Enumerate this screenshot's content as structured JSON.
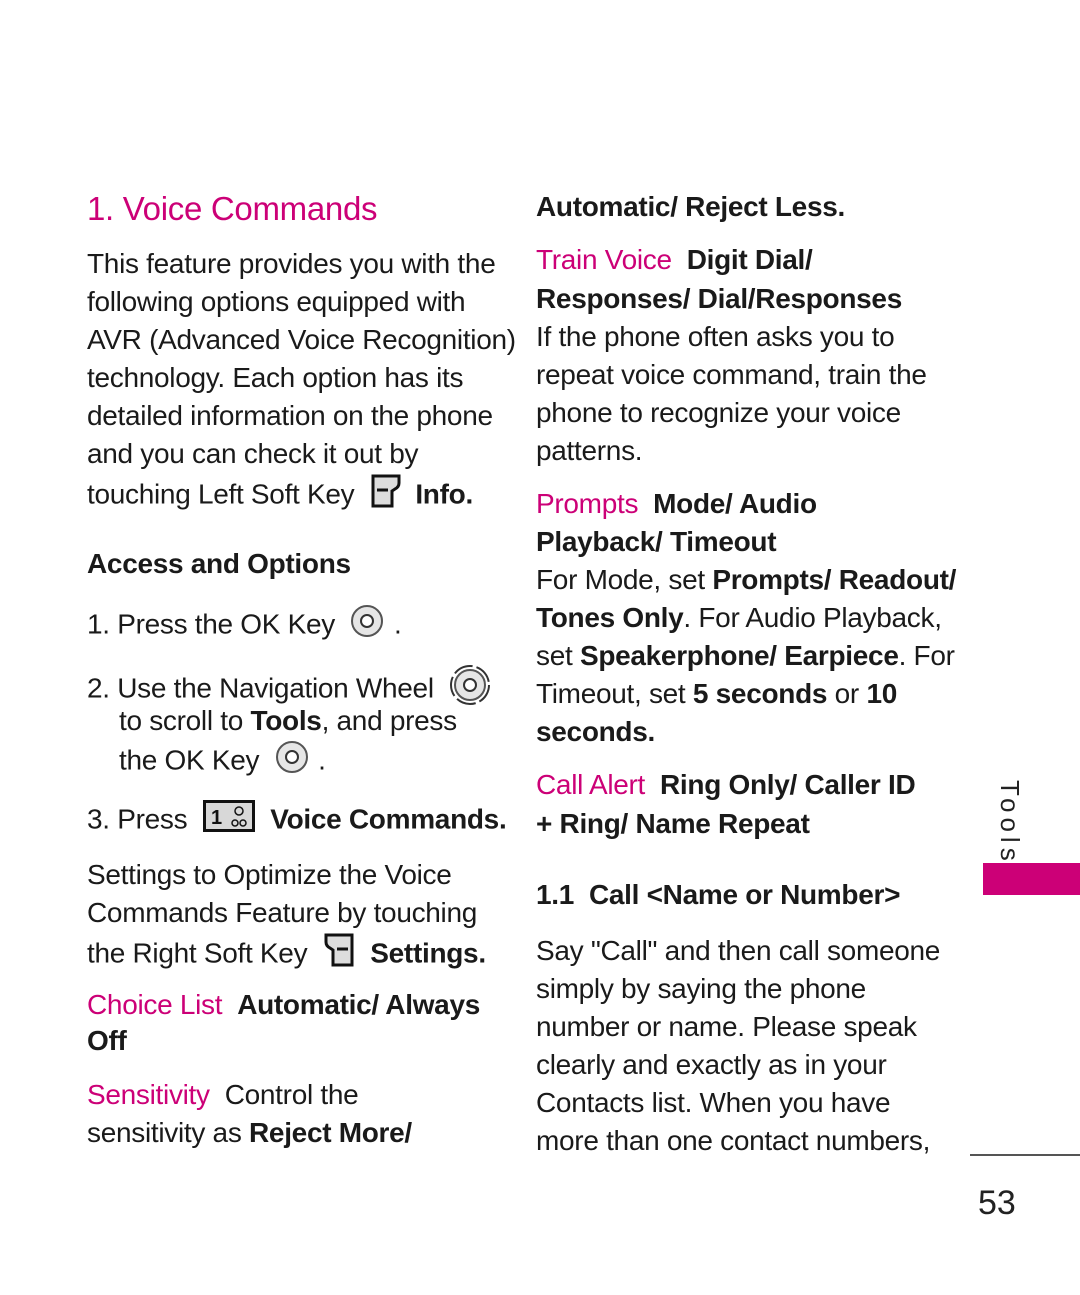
{
  "colors": {
    "accent": "#cc0077",
    "text": "#1a1a1a"
  },
  "section": {
    "title": "1. Voice Commands",
    "tab_label": "Tools",
    "page_number": "53"
  },
  "intro": {
    "lines": [
      "This feature provides you with the",
      "following options equipped with",
      "AVR (Advanced Voice Recognition)",
      "technology. Each option has its",
      "detailed information on the phone",
      "and you can check it out by",
      "touching Left Soft Key"
    ],
    "left_soft_key_label": "Info."
  },
  "access": {
    "heading": "Access and Options",
    "step1": {
      "text": "1. Press the OK Key",
      "end": "."
    },
    "step2": {
      "line1": "2. Use the Navigation Wheel",
      "line2_pre": "to scroll to ",
      "line2_bold": "Tools",
      "line2_post": ", and press",
      "line3": "the OK Key",
      "end": "."
    },
    "step3": {
      "text": "3. Press",
      "key_label": "1",
      "bold": "Voice Commands."
    }
  },
  "settings_intro": {
    "lines": [
      "Settings to Optimize the Voice",
      "Commands Feature by touching",
      "the Right Soft Key"
    ],
    "right_soft_key_label": "Settings."
  },
  "options": {
    "choice_list": {
      "label": "Choice List",
      "value_line1": "Automatic/ Always",
      "value_line2": "Off"
    },
    "sensitivity": {
      "label": "Sensitivity",
      "line1": "Control the",
      "line2_pre": "sensitivity as ",
      "line2_bold": "Reject More/",
      "line3_bold": "Automatic/ Reject Less."
    },
    "train_voice": {
      "label": "Train Voice",
      "value_line1": "Digit Dial/",
      "value_line2": "Responses/ Dial/Responses",
      "desc": [
        "If the phone often asks you to",
        "repeat voice command, train the",
        "phone to recognize your voice",
        "patterns."
      ]
    },
    "prompts": {
      "label": "Prompts",
      "value_line1": "Mode/ Audio",
      "value_line2": "Playback/ Timeout",
      "desc": {
        "l1_pre": "For Mode, set ",
        "l1_bold": "Prompts/ Readout/",
        "l2_bold": "Tones Only",
        "l2_post": ". For Audio Playback,",
        "l3_pre": "set ",
        "l3_bold": "Speakerphone/ Earpiece",
        "l3_post": ". For",
        "l4_pre": "Timeout, set ",
        "l4_bold1": "5 seconds",
        "l4_mid": " or ",
        "l4_bold2": "10",
        "l5_bold": "seconds."
      }
    },
    "call_alert": {
      "label": "Call Alert",
      "value_line1": "Ring Only/ Caller ID",
      "value_line2": "+ Ring/ Name Repeat"
    }
  },
  "subsection": {
    "heading": "1.1  Call <Name or Number>",
    "lines": [
      "Say \"Call\" and then call someone",
      "simply by saying the phone",
      "number or name. Please speak",
      "clearly and exactly as in your",
      "Contacts list. When you have",
      "more than one contact numbers,"
    ]
  }
}
